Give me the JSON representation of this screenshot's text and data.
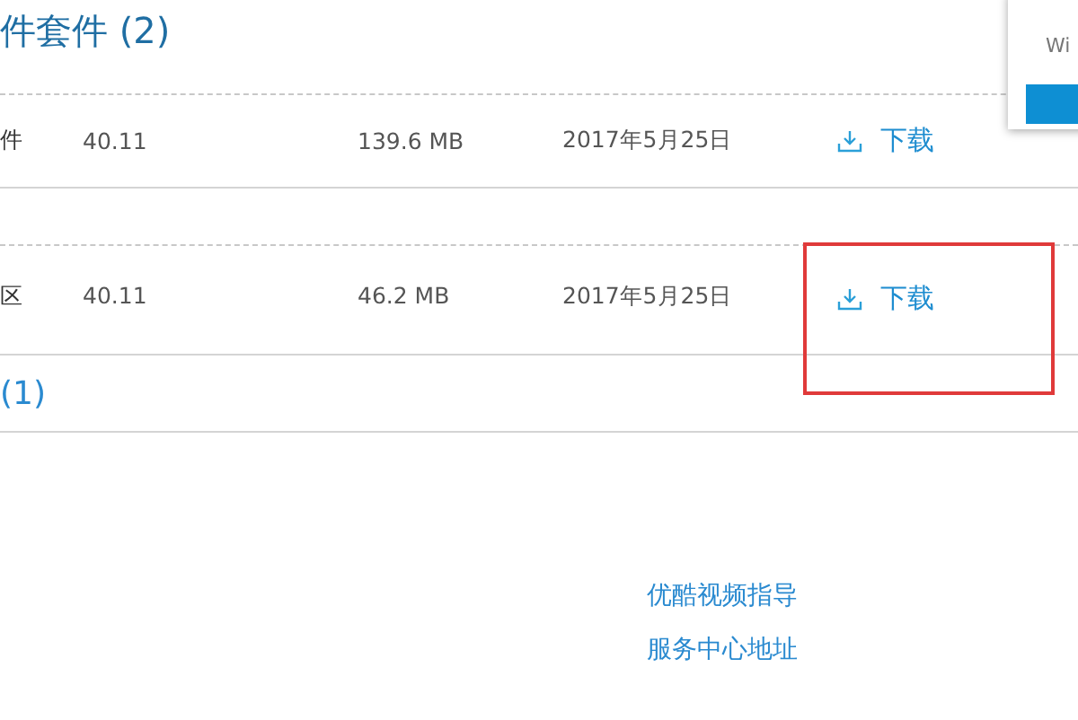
{
  "section_title": "件套件 (2)",
  "rows": [
    {
      "name": "件",
      "version": "40.11",
      "size": "139.6 MB",
      "date": "2017年5月25日",
      "action": "下载",
      "highlighted": false
    },
    {
      "name": "区",
      "version": "40.11",
      "size": "46.2 MB",
      "date": "2017年5月25日",
      "action": "下载",
      "highlighted": true
    }
  ],
  "next_section_title": "(1)",
  "popup": {
    "text": "Wi"
  },
  "footer_links": [
    "优酷视频指导",
    "服务中心地址"
  ]
}
